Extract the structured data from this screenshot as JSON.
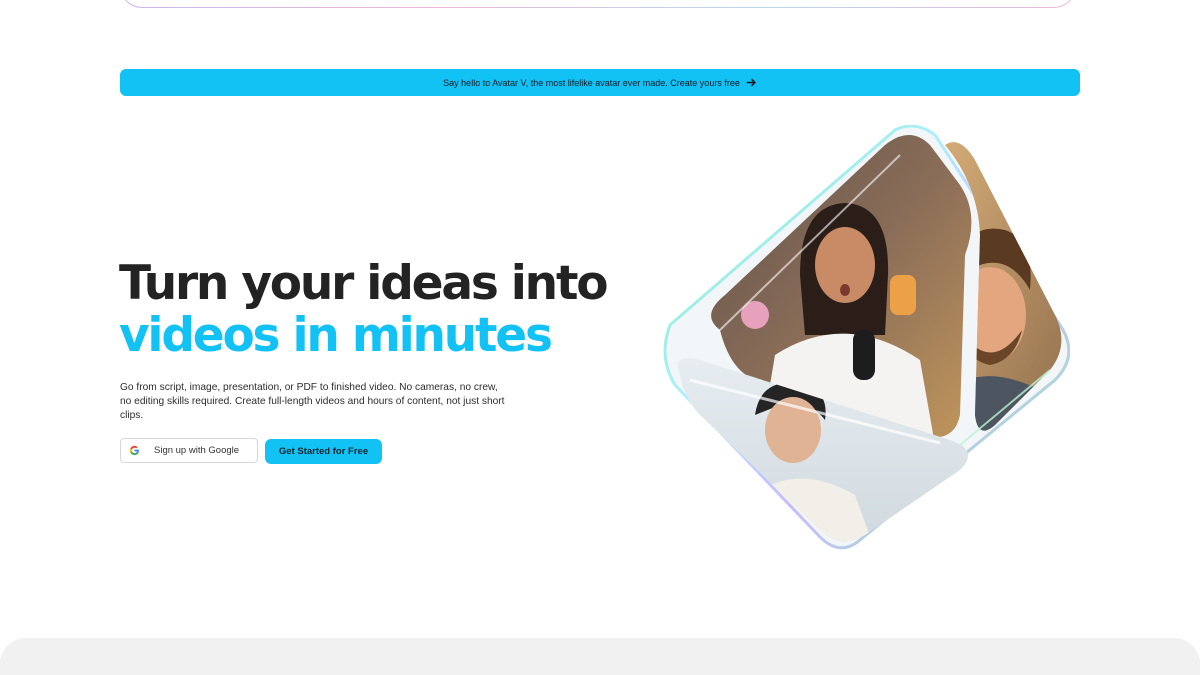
{
  "announcement": {
    "text": "Say hello to Avatar V, the most lifelike avatar ever made. Create yours free",
    "icon": "arrow-right-icon"
  },
  "hero": {
    "title_line1": "Turn your ideas into",
    "title_line2": "videos in minutes",
    "description": "Go from script, image, presentation, or PDF to finished video. No cameras, no crew, no editing skills required. Create full-length videos and hours of content, not just short clips.",
    "google_button_label": "Sign up with Google",
    "google_icon": "google-icon",
    "primary_button_label": "Get Started for Free"
  },
  "colors": {
    "accent": "#12c2f4",
    "title_dark": "#232323",
    "bottom_panel": "#f1f1f1"
  }
}
